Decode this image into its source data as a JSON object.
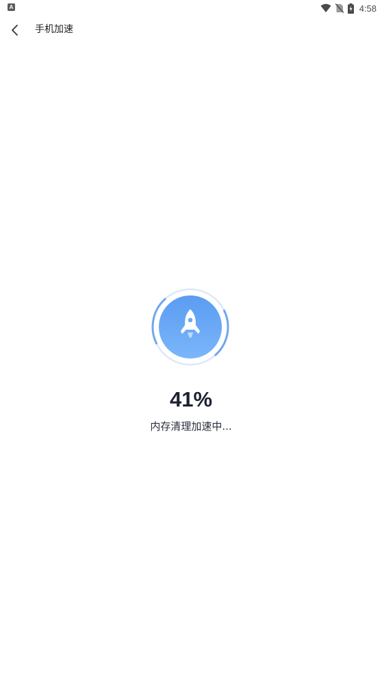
{
  "status_bar": {
    "notification_icon_label": "A",
    "time": "4:58",
    "icons": [
      "wifi-icon",
      "no-sim-icon",
      "battery-charging-icon"
    ]
  },
  "toolbar": {
    "back_icon": "chevron-left-icon",
    "title": "手机加速"
  },
  "progress": {
    "percent_value": 0.41,
    "percent_text": "41%",
    "message": "内存清理加速中...",
    "center_icon": "rocket-icon",
    "colors": {
      "circle_top": "#5b9cf2",
      "circle_bottom": "#7ab6fb",
      "ring": "#6fa6ef",
      "ring_faint": "#dbe8fb"
    }
  }
}
